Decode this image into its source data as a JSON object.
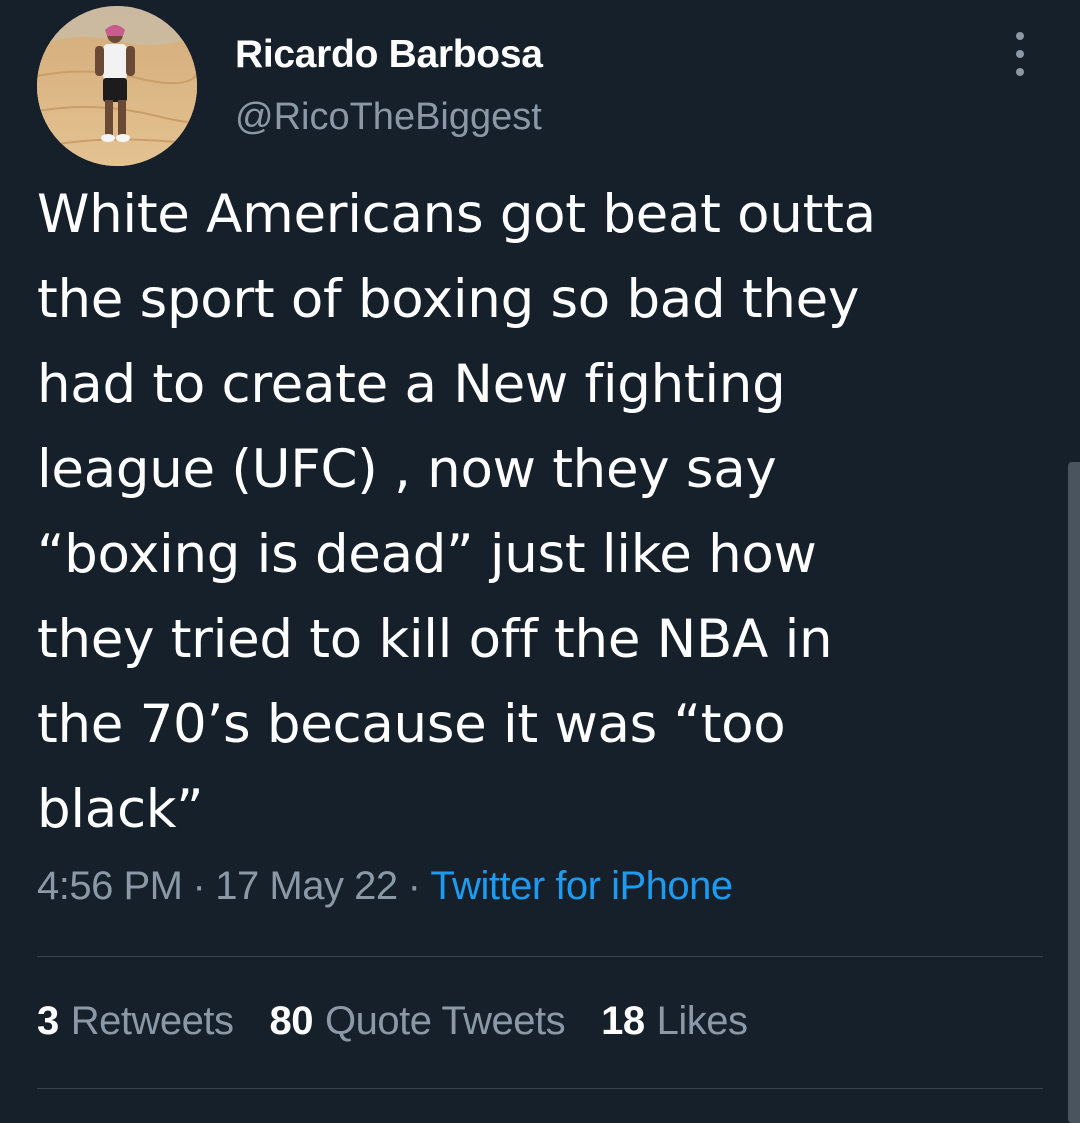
{
  "author": {
    "display_name": "Ricardo Barbosa",
    "handle": "@RicoTheBiggest",
    "avatar_icon": "profile-photo"
  },
  "tweet": {
    "lines": [
      "White Americans got beat outta",
      "the sport of boxing so bad they",
      "had to create a New fighting",
      "league (UFC) , now they say",
      "“boxing is dead” just like how",
      "they tried to kill off the NBA in",
      "the 70’s because it was “too",
      "black”"
    ]
  },
  "meta": {
    "time": "4:56 PM",
    "separator": "·",
    "date": "17 May 22",
    "source": "Twitter for iPhone"
  },
  "stats": {
    "retweets_count": "3",
    "retweets_label": "Retweets",
    "quotes_count": "80",
    "quotes_label": "Quote Tweets",
    "likes_count": "18",
    "likes_label": "Likes"
  },
  "colors": {
    "background": "#15202b",
    "text": "#ffffff",
    "secondary_text": "#8b98a5",
    "link": "#1d9bf0",
    "divider": "#38444d"
  }
}
